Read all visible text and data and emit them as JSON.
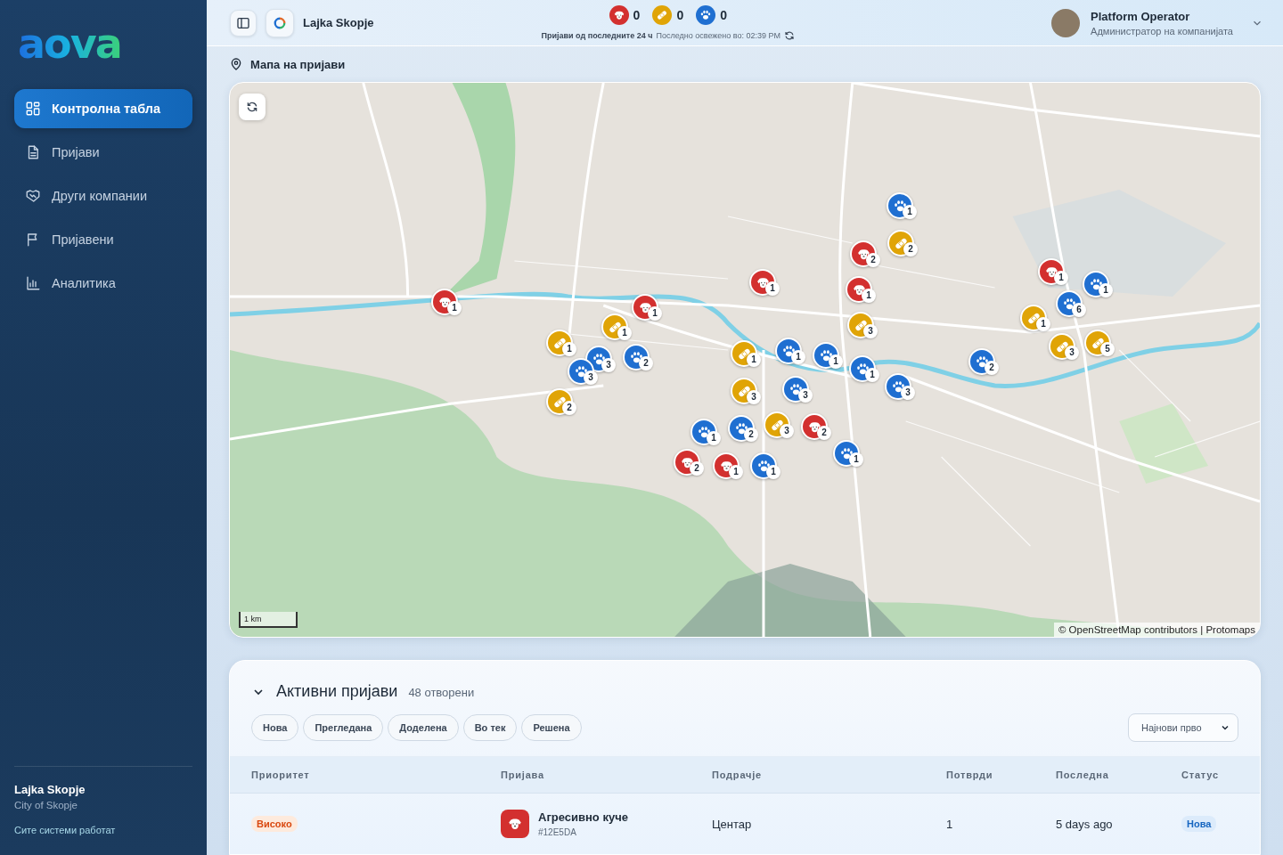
{
  "sidebar": {
    "logo": "aova",
    "items": [
      {
        "label": "Контролна табла",
        "kind": "dashboard",
        "selected": true
      },
      {
        "label": "Пријави",
        "kind": "document",
        "selected": false
      },
      {
        "label": "Други компании",
        "kind": "handshake",
        "selected": false
      },
      {
        "label": "Пријавени",
        "kind": "flag",
        "selected": false
      },
      {
        "label": "Аналитика",
        "kind": "chart",
        "selected": false
      }
    ],
    "footer": {
      "org": "Lajka Skopje",
      "city": "City of Skopje",
      "status": "Сите системи работат"
    }
  },
  "header": {
    "workspace": "Lajka Skopje",
    "counters": [
      {
        "kind": "dog",
        "count": "0"
      },
      {
        "kind": "bandage",
        "count": "0"
      },
      {
        "kind": "paw",
        "count": "0"
      }
    ],
    "window_label": "Пријави од последните 24 ч",
    "refreshed": "Последно освежено во: 02:39 PM",
    "user": {
      "name": "Platform Operator",
      "role": "Администратор на компанијата"
    }
  },
  "map": {
    "title": "Мапа на пријави",
    "scale": "1 km",
    "attribution": "© OpenStreetMap contributors | Protomaps",
    "markers": [
      {
        "kind": "paw",
        "count": "1"
      },
      {
        "kind": "bandage",
        "count": "2"
      },
      {
        "kind": "dog",
        "count": "2"
      },
      {
        "kind": "dog",
        "count": "1"
      },
      {
        "kind": "bandage",
        "count": "3"
      },
      {
        "kind": "dog",
        "count": "1"
      },
      {
        "kind": "dog",
        "count": "1"
      },
      {
        "kind": "dog",
        "count": "1"
      },
      {
        "kind": "paw",
        "count": "3"
      },
      {
        "kind": "paw",
        "count": "2"
      },
      {
        "kind": "bandage",
        "count": "1"
      },
      {
        "kind": "paw",
        "count": "3"
      },
      {
        "kind": "bandage",
        "count": "1"
      },
      {
        "kind": "bandage",
        "count": "2"
      },
      {
        "kind": "bandage",
        "count": "1"
      },
      {
        "kind": "bandage",
        "count": "3"
      },
      {
        "kind": "paw",
        "count": "1"
      },
      {
        "kind": "paw",
        "count": "1"
      },
      {
        "kind": "paw",
        "count": "3"
      },
      {
        "kind": "paw",
        "count": "3"
      },
      {
        "kind": "paw",
        "count": "1"
      },
      {
        "kind": "dog",
        "count": "2"
      },
      {
        "kind": "bandage",
        "count": "3"
      },
      {
        "kind": "dog",
        "count": "2"
      },
      {
        "kind": "paw",
        "count": "1"
      },
      {
        "kind": "paw",
        "count": "2"
      },
      {
        "kind": "dog",
        "count": "1"
      },
      {
        "kind": "paw",
        "count": "1"
      },
      {
        "kind": "paw",
        "count": "1"
      },
      {
        "kind": "paw",
        "count": "2"
      },
      {
        "kind": "dog",
        "count": "1"
      },
      {
        "kind": "paw",
        "count": "1"
      },
      {
        "kind": "paw",
        "count": "6"
      },
      {
        "kind": "bandage",
        "count": "1"
      },
      {
        "kind": "bandage",
        "count": "3"
      },
      {
        "kind": "bandage",
        "count": "5"
      }
    ]
  },
  "reports": {
    "title": "Активни пријави",
    "count": "48 отворени",
    "expanded": true,
    "filters": [
      {
        "label": "Нова",
        "selected": false
      },
      {
        "label": "Прегледана",
        "selected": false
      },
      {
        "label": "Доделена",
        "selected": false
      },
      {
        "label": "Во тек",
        "selected": false
      },
      {
        "label": "Решена",
        "selected": false
      }
    ],
    "sort": "Најнови прво",
    "columns": [
      "Приоритет",
      "Пријава",
      "Подрачје",
      "Потврди",
      "Последна",
      "Статус"
    ],
    "rows": [
      {
        "priority": "Високо",
        "kind": "dog",
        "title": "Агресивно куче",
        "id": "#12E5DA",
        "area": "Центар",
        "confirmations": "1",
        "last": "5 days ago",
        "status": "Нова"
      }
    ]
  }
}
